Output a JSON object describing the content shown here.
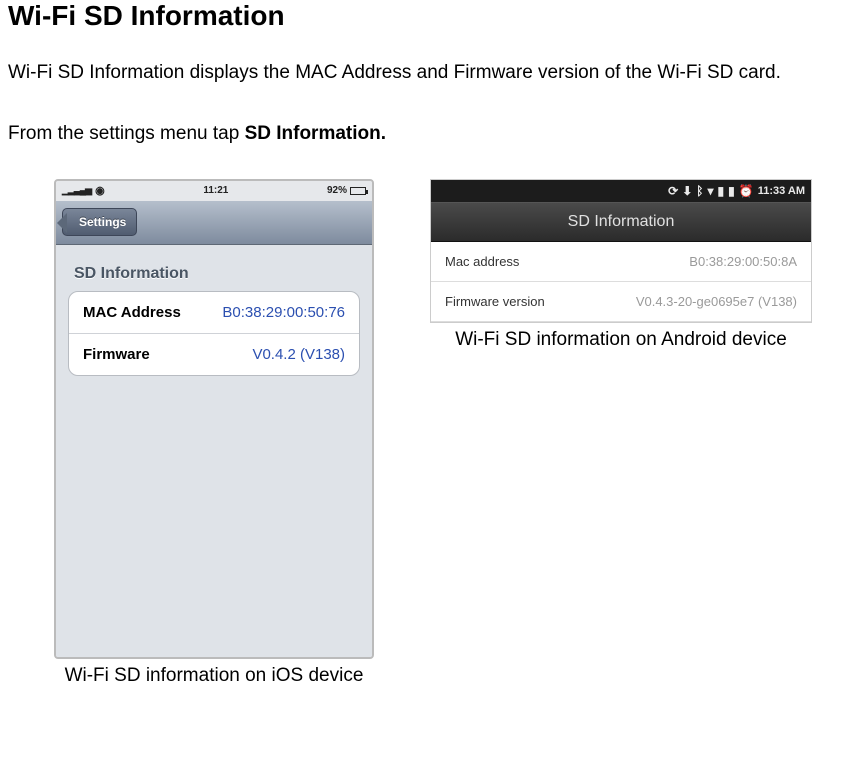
{
  "doc": {
    "title": "Wi-Fi SD Information",
    "intro": "Wi-Fi SD Information displays the MAC Address and Firmware version of the Wi-Fi SD card.",
    "instruction_prefix": "From the settings menu tap ",
    "instruction_bold": "SD Information.",
    "caption_ios": "Wi-Fi SD information on iOS device",
    "caption_android": "Wi-Fi SD information on Android device"
  },
  "ios": {
    "status": {
      "time": "11:21",
      "battery_pct": "92%"
    },
    "nav": {
      "back_label": "Settings"
    },
    "section_label": "SD Information",
    "rows": {
      "mac": {
        "label": "MAC Address",
        "value": "B0:38:29:00:50:76"
      },
      "firmware": {
        "label": "Firmware",
        "value": "V0.4.2 (V138)"
      }
    }
  },
  "android": {
    "status": {
      "time": "11:33 AM"
    },
    "nav": {
      "title": "SD Information"
    },
    "rows": {
      "mac": {
        "label": "Mac address",
        "value": "B0:38:29:00:50:8A"
      },
      "firmware": {
        "label": "Firmware version",
        "value": "V0.4.3-20-ge0695e7 (V138)"
      }
    }
  }
}
